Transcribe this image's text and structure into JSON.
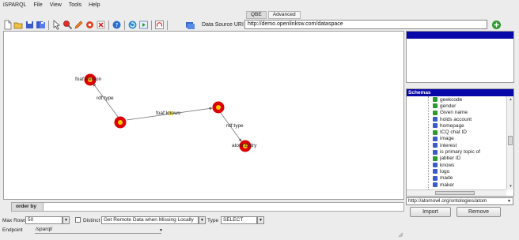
{
  "menu": [
    "iSPARQL",
    "File",
    "View",
    "Tools",
    "Help"
  ],
  "mode_tabs": [
    {
      "label": "QBE",
      "active": true
    },
    {
      "label": "Advanced",
      "active": false
    }
  ],
  "toolbar": {
    "icons": [
      "new-icon",
      "open-icon",
      "save-icon",
      "save-as-icon",
      "select-icon",
      "search-icon",
      "pencil-icon",
      "gear-icon",
      "delete-icon",
      "help-icon",
      "refresh-icon",
      "run-icon",
      "print-icon",
      "datasource-icon"
    ],
    "datasource_label": "Data Source URI",
    "datasource_value": "http://demo.openlinksw.com/dataspace"
  },
  "graph": {
    "edge_labels": [
      "rdf:type",
      "foaf:knows",
      "rdf:type"
    ],
    "node_labels": [
      "foaf:Person",
      "atom:Entry"
    ]
  },
  "order_by": {
    "label": "order by"
  },
  "options": {
    "max_rows_label": "Max Rows",
    "max_rows_value": "50",
    "distinct_label": "Distinct",
    "distinct_checked": false,
    "remote_value": "Get Remote Data when Missing Locally",
    "type_label": "Type",
    "type_value": "SELECT"
  },
  "endpoint": {
    "label": "Endpoint",
    "value": "/sparql/"
  },
  "schemas": {
    "title": "Schemas",
    "items": [
      {
        "label": "geekcode",
        "kind": "g"
      },
      {
        "label": "gender",
        "kind": "g"
      },
      {
        "label": "Given name",
        "kind": "g"
      },
      {
        "label": "holds account",
        "kind": "b"
      },
      {
        "label": "homepage",
        "kind": "b"
      },
      {
        "label": "ICQ chat ID",
        "kind": "g"
      },
      {
        "label": "image",
        "kind": "b"
      },
      {
        "label": "interest",
        "kind": "b"
      },
      {
        "label": "is primary topic of",
        "kind": "b"
      },
      {
        "label": "jabber ID",
        "kind": "g"
      },
      {
        "label": "knows",
        "kind": "b"
      },
      {
        "label": "logo",
        "kind": "b"
      },
      {
        "label": "made",
        "kind": "b"
      },
      {
        "label": "maker",
        "kind": "b"
      }
    ],
    "url_value": "http://atomowl.org/ontologies/atom",
    "import_label": "Import",
    "remove_label": "Remove"
  },
  "colors": {
    "header_blue": "#0808a8",
    "node_red": "#dd0000",
    "node_core": "#ffcc00",
    "add_green": "#2e9a2e"
  }
}
